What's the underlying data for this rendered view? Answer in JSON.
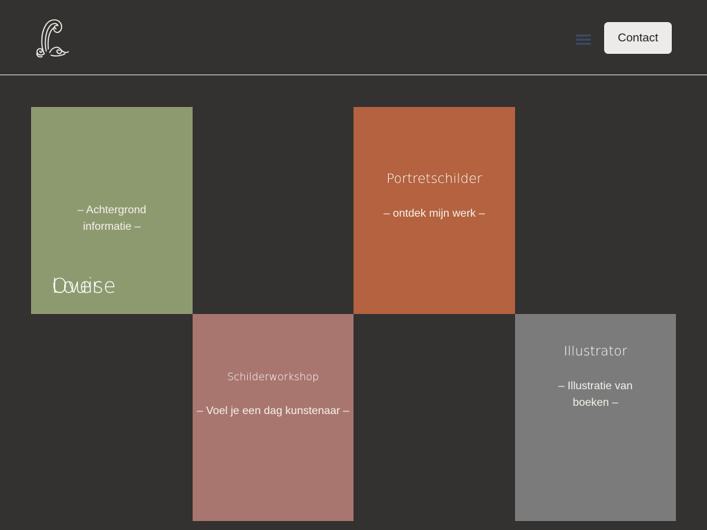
{
  "colors": {
    "background": "#343131",
    "header_divider": "#e6e2dd",
    "menu_icon": "#3b4a63",
    "contact_button_bg": "#ecebea",
    "tile_over": "#8d9a6f",
    "tile_portret": "#b4623f",
    "tile_workshop": "#a8766f",
    "tile_illustrator": "#7b7b7b"
  },
  "header": {
    "logo_icon": "swirl-signature-logo-icon",
    "menu_icon": "hamburger-menu-icon",
    "contact_label": "Contact"
  },
  "tiles": {
    "over": {
      "title_line1": "Over",
      "title_line2": "Louise",
      "sub_line1": "– Achtergrond",
      "sub_line2": "informatie –"
    },
    "portret": {
      "title": "Portretschilder",
      "sub": "– ontdek mijn werk –"
    },
    "workshop": {
      "title": "Schilderworkshop",
      "sub": "– Voel je een dag kunstenaar –"
    },
    "illustrator": {
      "title": "Illustrator",
      "sub_line1": "– Illustratie van",
      "sub_line2": "boeken –"
    }
  }
}
